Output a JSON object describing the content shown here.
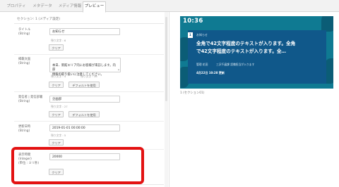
{
  "tabs": [
    {
      "label": "プロパティ"
    },
    {
      "label": "メタデータ"
    },
    {
      "label": "メディア情報"
    },
    {
      "label": "プレビュー"
    }
  ],
  "section": {
    "title": "セクション: 1 (メディア設定)"
  },
  "fields": {
    "title": {
      "label": "タイトル\n(String)",
      "value": "お知らせ",
      "remaining": "残り文字 : 6",
      "clear": "クリア"
    },
    "body": {
      "label": "掲載文面\n(String)",
      "value": "本日、新館エリア内にお客様が来訪します。内部\n情報の取り扱いに注意してください。",
      "grip": "▴",
      "remaining_left": "残り文字 : 4",
      "remaining_right": "残り文字 : 36",
      "clear": "クリア",
      "default": "デフォルトを使用"
    },
    "sender": {
      "label": "発信者 | 発信部署\n(String)",
      "value": "企画部",
      "remaining": "残り文字 : 27",
      "clear": "クリア",
      "default": "デフォルトを使用"
    },
    "datetime": {
      "label": "更新日時\n(String)",
      "value": "2019-01-01 00:00:00",
      "remaining": "残り文字 : 5",
      "clear": "クリア"
    },
    "duration": {
      "label": "表示時間\n(Integer)\n(単位 : ミリ秒)",
      "value": "20000",
      "clear": "クリア"
    }
  },
  "preview": {
    "clock": "10:36",
    "badge_digit": "1",
    "category": "お知らせ",
    "headline": "全角で42文字程度のテキストが入ります。全角\nで42文字程度のテキストが入ります。全…",
    "meta_author": "管理 花田",
    "meta_dept": "三沢千晶課 設備担当が入ります",
    "date": "4月22日 10:28 更新",
    "caption": "1 (セクション01)"
  }
}
